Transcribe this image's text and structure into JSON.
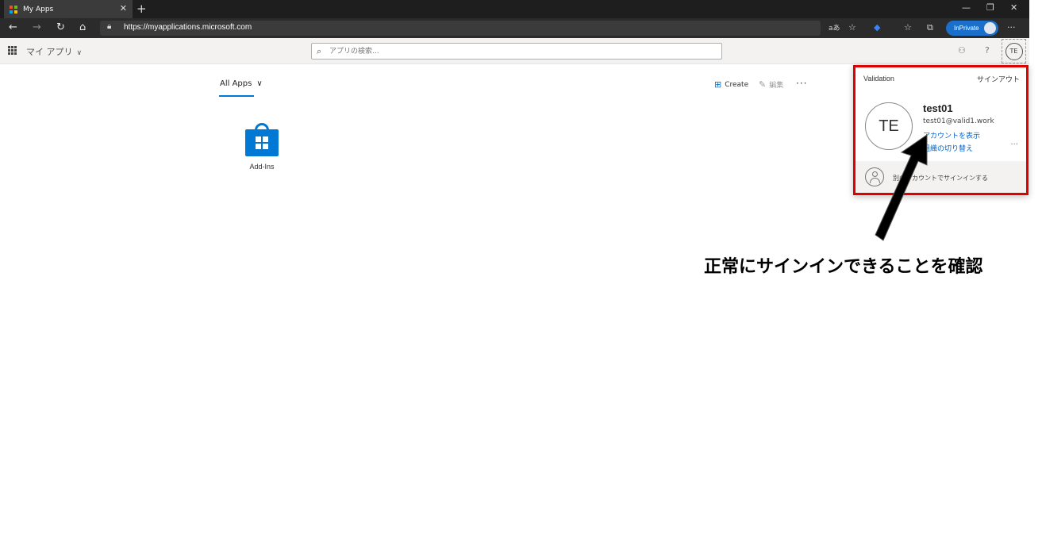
{
  "browser": {
    "tab_title": "My Apps",
    "tab_close": "✕",
    "new_tab": "+",
    "window_controls": [
      "—",
      "❐",
      "✕"
    ],
    "url": "https://myapplications.microsoft.com",
    "inprivate_label": "InPrivate"
  },
  "header": {
    "app_name": "マイ アプリ",
    "search_placeholder": "アプリの検索...",
    "help": "?",
    "avatar_initials": "TE"
  },
  "main": {
    "collection_label": "All Apps",
    "create_label": "Create",
    "edit_label": "編集",
    "more": "···",
    "apps": [
      {
        "name": "Add-Ins"
      }
    ]
  },
  "account_flyout": {
    "org": "Validation",
    "sign_out": "サインアウト",
    "initials": "TE",
    "display_name": "test01",
    "email": "test01@valid1.work",
    "view_account": "アカウントを表示",
    "switch_org": "組織の切り替え",
    "more": "···",
    "other_account": "別のアカウントでサインインする"
  },
  "annotation": {
    "caption": "正常にサインインできることを確認"
  },
  "colors": {
    "accent": "#0078d4",
    "highlight_border": "#e00000",
    "inprivate": "#1a6fcb"
  }
}
